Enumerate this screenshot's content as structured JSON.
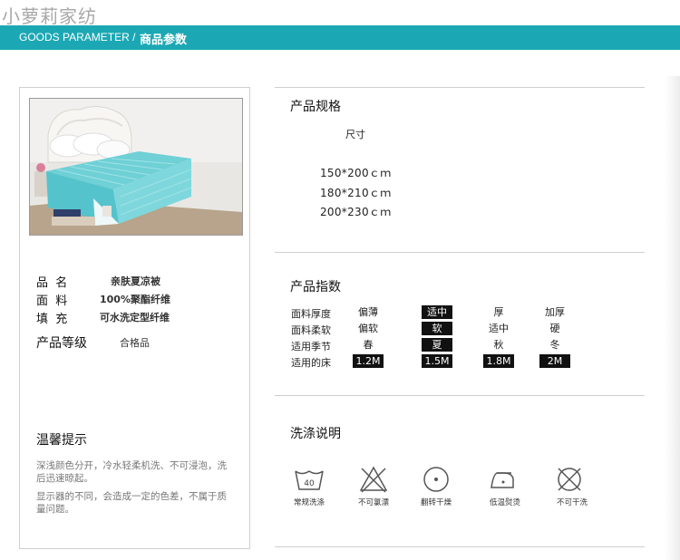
{
  "watermark": "小萝莉家纺",
  "header": {
    "en_label": "GOODS  PARAMETER /",
    "cn_label": "商品参数"
  },
  "product": {
    "image_alt": "bed-with-mint-summer-quilt",
    "name_key": "品  名",
    "name_val": "亲肤夏凉被",
    "fabric_key": "面  料",
    "fabric_val": "100%聚酯纤维",
    "fill_key": "填  充",
    "fill_val": "可水洗定型纤维",
    "grade_key": "产品等级",
    "grade_val": "合格品"
  },
  "tips": {
    "title": "温馨提示",
    "line1": "深浅颜色分开，冷水轻柔机洗、不可浸泡，洗后迅速晾起。",
    "line2": "显示器的不同，会造成一定的色差，不属于质量问题。"
  },
  "spec": {
    "title": "产品规格",
    "size_header": "尺寸",
    "sizes": [
      "150*200ｃｍ",
      "180*210ｃｍ",
      "200*230ｃｍ"
    ]
  },
  "index": {
    "title": "产品指数",
    "rows": [
      {
        "label": "面料厚度",
        "options": [
          "偏薄",
          "适中",
          "厚",
          "加厚"
        ],
        "selected": [
          1
        ]
      },
      {
        "label": "面料柔软",
        "options": [
          "偏软",
          "软",
          "适中",
          "硬"
        ],
        "selected": [
          1
        ]
      },
      {
        "label": "适用季节",
        "options": [
          "春",
          "夏",
          "秋",
          "冬"
        ],
        "selected": [
          1
        ]
      },
      {
        "label": "适用的床",
        "options": [
          "1.2M",
          "1.5M",
          "1.8M",
          "2M"
        ],
        "selected": [
          0,
          1,
          2,
          3
        ]
      }
    ]
  },
  "wash": {
    "title": "洗涤说明",
    "items": [
      {
        "icon": "wash-40-icon",
        "label": "常规洗涤",
        "temp": "40"
      },
      {
        "icon": "no-bleach-icon",
        "label": "不可氯漂"
      },
      {
        "icon": "tumble-dry-icon",
        "label": "翻转干燥"
      },
      {
        "icon": "low-iron-icon",
        "label": "低温熨烫"
      },
      {
        "icon": "no-dry-clean-icon",
        "label": "不可干洗"
      }
    ]
  }
}
